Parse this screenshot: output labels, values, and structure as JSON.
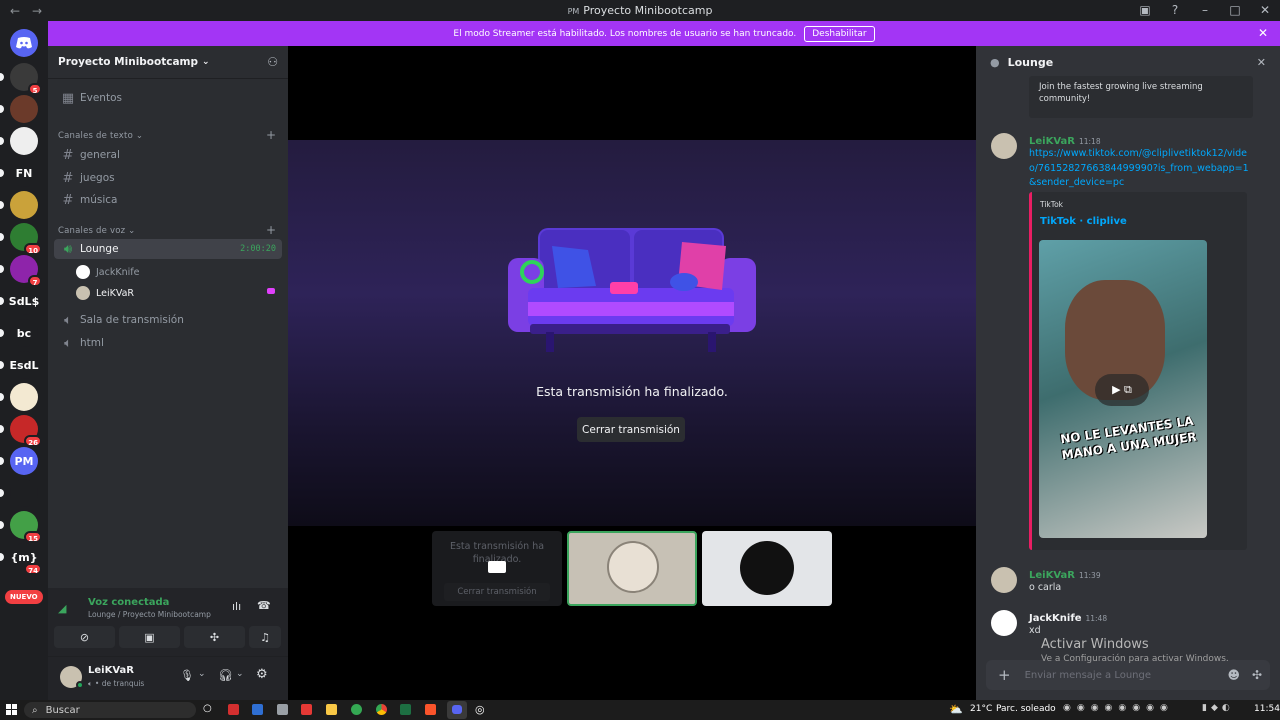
{
  "titlebar": {
    "app_title": "Proyecto Minibootcamp",
    "back": "←",
    "forward": "→"
  },
  "banner": {
    "text": "El modo Streamer está habilitado. Los nombres de usuario se han truncado.",
    "button": "Deshabilitar"
  },
  "rail": {
    "servers": [
      {
        "label": "",
        "badge": "5"
      },
      {
        "label": "",
        "badge": ""
      },
      {
        "label": "",
        "badge": ""
      },
      {
        "label": "FN",
        "badge": ""
      },
      {
        "label": "",
        "badge": ""
      },
      {
        "label": "",
        "badge": "10"
      },
      {
        "label": "",
        "badge": "7"
      },
      {
        "label": "SdL$",
        "badge": ""
      },
      {
        "label": "bc",
        "badge": ""
      },
      {
        "label": "EsdL",
        "badge": ""
      },
      {
        "label": "",
        "badge": ""
      },
      {
        "label": "",
        "badge": "26"
      },
      {
        "label": "PM",
        "badge": ""
      },
      {
        "label": "",
        "badge": ""
      },
      {
        "label": "",
        "badge": "15"
      },
      {
        "label": "{m}",
        "badge": "74"
      }
    ],
    "nuevo": "NUEVO"
  },
  "sidebar": {
    "guild_name": "Proyecto Minibootcamp",
    "events": "Eventos",
    "text_category": "Canales de texto",
    "text_channels": [
      "general",
      "juegos",
      "música"
    ],
    "voice_category": "Canales de voz",
    "voice_channels": {
      "lounge": "Lounge",
      "lounge_timer": "2:00:20",
      "stage": "Sala de transmisión",
      "html": "html"
    },
    "voice_users": [
      "JackKnife",
      "LeiKVaR"
    ]
  },
  "voice": {
    "status": "Voz conectada",
    "location": "Lounge / Proyecto Minibootcamp"
  },
  "user": {
    "name": "LeiKVaR",
    "status": "de tranquis"
  },
  "stage": {
    "ended": "Esta transmisión ha finalizado.",
    "close": "Cerrar transmisión",
    "tile_ended": "Esta transmisión ha finalizado.",
    "tile_close": "Cerrar transmisión"
  },
  "chat": {
    "channel": "Lounge",
    "quote": "Join the fastest growing live streaming community!",
    "messages": [
      {
        "author": "LeiKVaR",
        "time": "11:18",
        "text": "https://www.tiktok.com/@cliplivetiktok12/video/7615282766384499990?is_from_webapp=1&sender_device=pc"
      },
      {
        "author": "LeiKVaR",
        "time": "11:39",
        "text": "o carla"
      },
      {
        "author": "JackKnife",
        "time": "11:48",
        "text": "xd"
      }
    ],
    "embed": {
      "provider": "TikTok",
      "title": "TikTok · cliplive",
      "caption_line1": "NO LE LEVANTES LA",
      "caption_line2": "MANO A UNA MUJER"
    },
    "input_placeholder": "Enviar mensaje a Lounge"
  },
  "watermark": {
    "line1": "Activar Windows",
    "line2": "Ve a Configuración para activar Windows."
  },
  "taskbar": {
    "search": "Buscar",
    "temp": "21°C",
    "weather": "Parc. soleado",
    "clock": "11:54"
  }
}
